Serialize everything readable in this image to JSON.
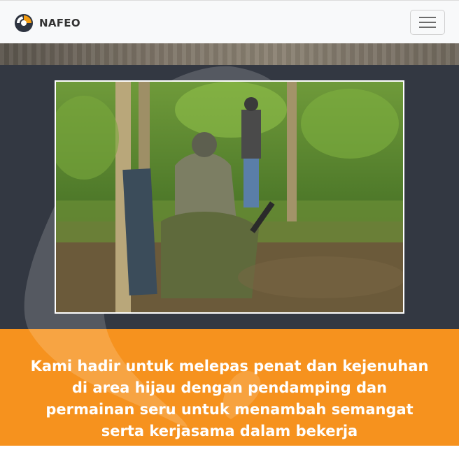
{
  "navbar": {
    "brand_name": "NAFEO",
    "logo_icon": "nafeo-logo-icon",
    "menu_icon": "hamburger-menu-icon"
  },
  "hero": {
    "photo_description_icon": "photo-image",
    "tagline": "Kami hadir untuk melepas penat dan kejenuhan di area hijau dengan pendamping dan permainan seru untuk menambah semangat serta kerjasama dalam bekerja"
  },
  "colors": {
    "navbar_bg": "#f8f9fa",
    "dark_section": "#333842",
    "accent_orange": "#f6921e",
    "logo_orange": "#f39c12",
    "logo_dark": "#2e3440"
  }
}
